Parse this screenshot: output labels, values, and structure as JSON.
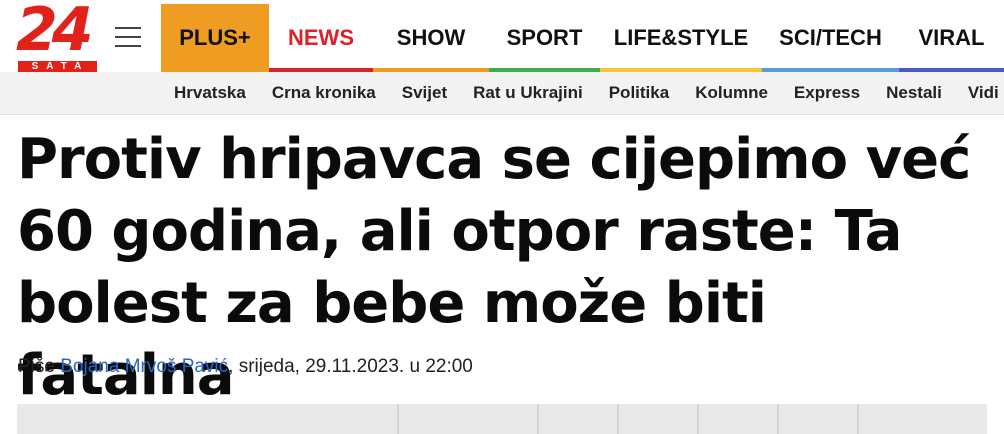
{
  "logo": {
    "number": "24",
    "subtitle": "SATA"
  },
  "nav": {
    "items": [
      {
        "label": "PLUS+",
        "color": "#ef9c23"
      },
      {
        "label": "NEWS",
        "color": "#d9232a"
      },
      {
        "label": "SHOW",
        "color": "#ef9c23"
      },
      {
        "label": "SPORT",
        "color": "#3eae4d"
      },
      {
        "label": "LIFE&STYLE",
        "color": "#f2c53c"
      },
      {
        "label": "SCI/TECH",
        "color": "#5b9bd8"
      },
      {
        "label": "VIRAL",
        "color": "#4b59c7"
      }
    ]
  },
  "subnav": {
    "items": [
      "Hrvatska",
      "Crna kronika",
      "Svijet",
      "Rat u Ukrajini",
      "Politika",
      "Kolumne",
      "Express",
      "Nestali",
      "Vidi"
    ]
  },
  "article": {
    "headline": "Protiv hripavca se cijepimo već 60 godina, ali otpor raste: Ta bolest za bebe može biti fatalna",
    "byline_prefix": "Piše",
    "author": "Bojana Mrvoš Pavić",
    "date": ", srijeda, 29.11.2023. u 22:00"
  }
}
